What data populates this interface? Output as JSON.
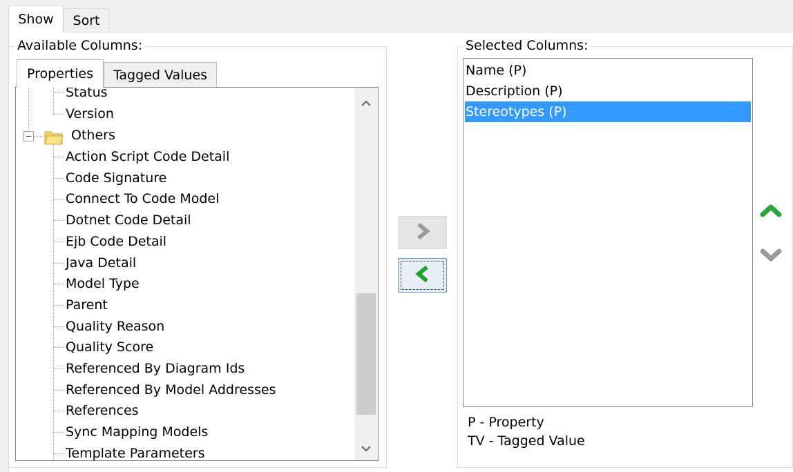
{
  "tabs": [
    {
      "label": "Show",
      "active": true
    },
    {
      "label": "Sort",
      "active": false
    }
  ],
  "available_columns": {
    "title": "Available Columns:",
    "tabs": [
      {
        "label": "Properties",
        "active": true
      },
      {
        "label": "Tagged Values",
        "active": false
      }
    ],
    "tree": {
      "items_above": [
        "Status",
        "Version"
      ],
      "folder": {
        "label": "Others",
        "expanded": true,
        "icon": "folder-icon"
      },
      "children": [
        "Action Script Code Detail",
        "Code Signature",
        "Connect To Code Model",
        "Dotnet Code Detail",
        "Ejb Code Detail",
        "Java Detail",
        "Model Type",
        "Parent",
        "Quality Reason",
        "Quality Score",
        "Referenced By Diagram Ids",
        "Referenced By Model Addresses",
        "References",
        "Sync Mapping Models",
        "Template Parameters"
      ]
    }
  },
  "transfer_buttons": {
    "add_icon": "chevron-right-icon",
    "remove_icon": "chevron-left-icon",
    "add_color": "#9a9a9a",
    "remove_color": "#1fa22e"
  },
  "selected_columns": {
    "title": "Selected Columns:",
    "items": [
      {
        "label": "Name (P)",
        "selected": false
      },
      {
        "label": "Description (P)",
        "selected": false
      },
      {
        "label": "Stereotypes (P)",
        "selected": true
      }
    ],
    "selection_color": "#3399ff"
  },
  "order_buttons": {
    "up_icon": "chevron-up-icon",
    "down_icon": "chevron-down-icon",
    "up_color": "#2aa537",
    "down_color": "#9a9a9a"
  },
  "legend": {
    "property": "P - Property",
    "tagged_value": "TV - Tagged Value"
  }
}
